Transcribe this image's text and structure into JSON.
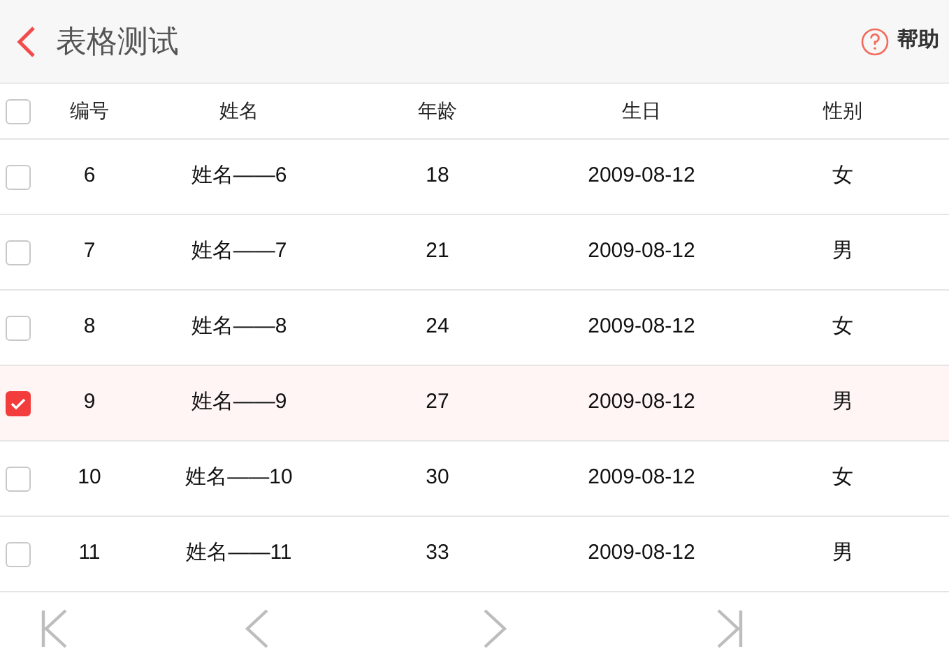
{
  "header": {
    "title": "表格测试",
    "help": "帮助"
  },
  "table": {
    "select_all": {
      "checked": false
    },
    "columns": [
      "编号",
      "姓名",
      "年龄",
      "生日",
      "性别"
    ],
    "rows": [
      {
        "selected": false,
        "cells": [
          "6",
          "姓名——6",
          "18",
          "2009-08-12",
          "女"
        ]
      },
      {
        "selected": false,
        "cells": [
          "7",
          "姓名——7",
          "21",
          "2009-08-12",
          "男"
        ]
      },
      {
        "selected": false,
        "cells": [
          "8",
          "姓名——8",
          "24",
          "2009-08-12",
          "女"
        ]
      },
      {
        "selected": true,
        "cells": [
          "9",
          "姓名——9",
          "27",
          "2009-08-12",
          "男"
        ]
      },
      {
        "selected": false,
        "cells": [
          "10",
          "姓名——10",
          "30",
          "2009-08-12",
          "女"
        ]
      },
      {
        "selected": false,
        "cells": [
          "11",
          "姓名——11",
          "33",
          "2009-08-12",
          "男"
        ]
      }
    ]
  },
  "pager": [
    {
      "kind": "first"
    },
    {
      "kind": "prev"
    },
    {
      "kind": "next"
    },
    {
      "kind": "last"
    }
  ]
}
